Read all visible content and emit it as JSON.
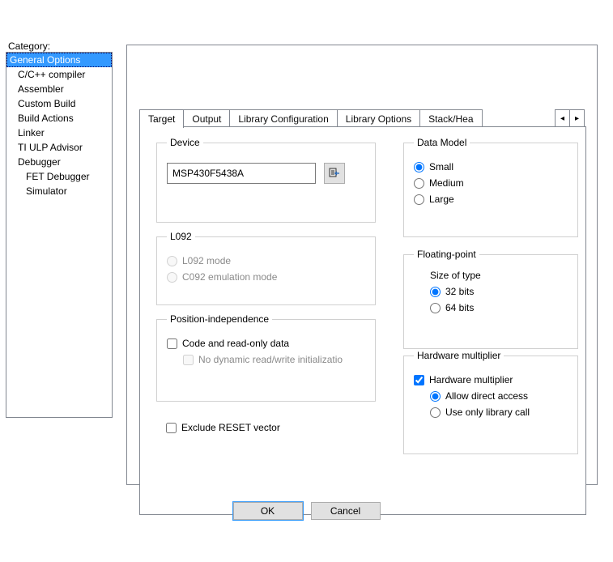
{
  "categoryLabel": "Category:",
  "categories": [
    {
      "label": "General Options",
      "indent": 0,
      "selected": true
    },
    {
      "label": "C/C++ compiler",
      "indent": 1,
      "selected": false
    },
    {
      "label": "Assembler",
      "indent": 1,
      "selected": false
    },
    {
      "label": "Custom Build",
      "indent": 1,
      "selected": false
    },
    {
      "label": "Build Actions",
      "indent": 1,
      "selected": false
    },
    {
      "label": "Linker",
      "indent": 1,
      "selected": false
    },
    {
      "label": "TI ULP Advisor",
      "indent": 1,
      "selected": false
    },
    {
      "label": "Debugger",
      "indent": 1,
      "selected": false
    },
    {
      "label": "FET Debugger",
      "indent": 2,
      "selected": false
    },
    {
      "label": "Simulator",
      "indent": 2,
      "selected": false
    }
  ],
  "tabs": [
    "Target",
    "Output",
    "Library Configuration",
    "Library Options",
    "Stack/Hea"
  ],
  "tabActive": 0,
  "tabLeftGlyph": "◂",
  "tabRightGlyph": "▸",
  "device": {
    "legend": "Device",
    "value": "MSP430F5438A"
  },
  "l092": {
    "legend": "L092",
    "opt1": "L092 mode",
    "opt2": "C092 emulation mode"
  },
  "posind": {
    "legend": "Position-independence",
    "opt1": "Code and read-only data",
    "opt2": "No dynamic read/write initializatio"
  },
  "excludeReset": "Exclude RESET vector",
  "dataModel": {
    "legend": "Data Model",
    "opt1": "Small",
    "opt2": "Medium",
    "opt3": "Large"
  },
  "floating": {
    "legend": "Floating-point",
    "subhead": "Size of type",
    "opt1": "32 bits",
    "opt2": "64 bits"
  },
  "hwmult": {
    "legend": "Hardware multiplier",
    "chk": "Hardware multiplier",
    "opt1": "Allow direct access",
    "opt2": "Use only library call"
  },
  "buttons": {
    "ok": "OK",
    "cancel": "Cancel"
  }
}
